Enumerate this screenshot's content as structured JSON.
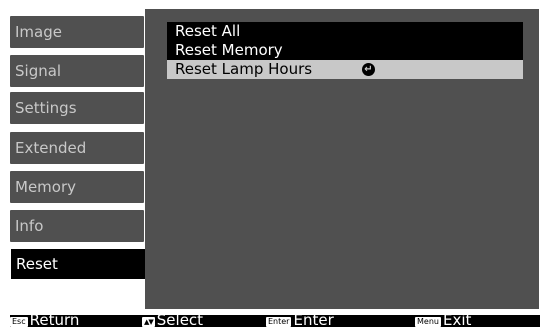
{
  "sidebar": {
    "items": [
      {
        "label": "Image"
      },
      {
        "label": "Signal"
      },
      {
        "label": "Settings"
      },
      {
        "label": "Extended"
      },
      {
        "label": "Memory"
      },
      {
        "label": "Info"
      },
      {
        "label": "Reset"
      }
    ],
    "active": "Reset"
  },
  "panel": {
    "items": [
      {
        "label": "Reset All"
      },
      {
        "label": "Reset Memory"
      },
      {
        "label": "Reset Lamp Hours"
      }
    ],
    "selected": "Reset Lamp Hours",
    "enter_icon": "enter-return-icon"
  },
  "footer": {
    "return": {
      "key": "Esc",
      "label": "Return"
    },
    "select": {
      "key": "arrows",
      "label": "Select"
    },
    "enter": {
      "key": "Enter",
      "label": "Enter"
    },
    "exit": {
      "key": "Menu",
      "label": "Exit"
    }
  },
  "colors": {
    "panel_bg": "#505050",
    "active_bg": "#000000",
    "selected_bg": "#c8c8c8"
  }
}
